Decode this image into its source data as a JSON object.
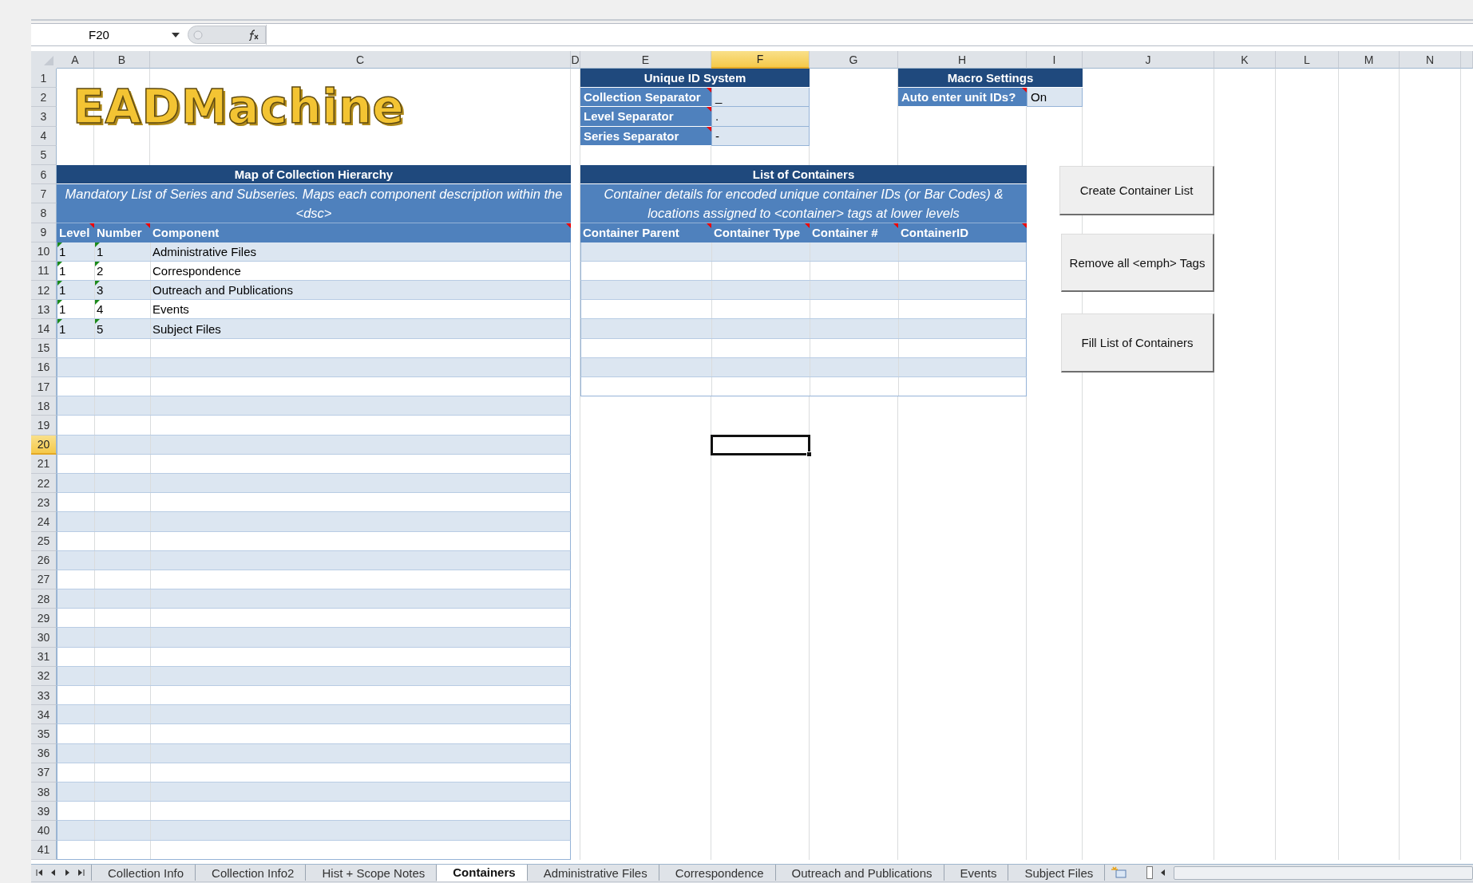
{
  "formula_bar": {
    "name_box": "F20"
  },
  "columns": [
    {
      "label": "A",
      "selected": false
    },
    {
      "label": "B",
      "selected": false
    },
    {
      "label": "C",
      "selected": false
    },
    {
      "label": "D",
      "selected": false
    },
    {
      "label": "E",
      "selected": false
    },
    {
      "label": "F",
      "selected": true
    },
    {
      "label": "G",
      "selected": false
    },
    {
      "label": "H",
      "selected": false
    },
    {
      "label": "I",
      "selected": false
    },
    {
      "label": "J",
      "selected": false
    },
    {
      "label": "K",
      "selected": false
    },
    {
      "label": "L",
      "selected": false
    },
    {
      "label": "M",
      "selected": false
    },
    {
      "label": "N",
      "selected": false
    }
  ],
  "rows": [
    {
      "label": "1",
      "selected": false
    },
    {
      "label": "2",
      "selected": false
    },
    {
      "label": "3",
      "selected": false
    },
    {
      "label": "4",
      "selected": false
    },
    {
      "label": "5",
      "selected": false
    },
    {
      "label": "6",
      "selected": false
    },
    {
      "label": "7",
      "selected": false
    },
    {
      "label": "8",
      "selected": false
    },
    {
      "label": "9",
      "selected": false
    },
    {
      "label": "10",
      "selected": false
    },
    {
      "label": "11",
      "selected": false
    },
    {
      "label": "12",
      "selected": false
    },
    {
      "label": "13",
      "selected": false
    },
    {
      "label": "14",
      "selected": false
    },
    {
      "label": "15",
      "selected": false
    },
    {
      "label": "16",
      "selected": false
    },
    {
      "label": "17",
      "selected": false
    },
    {
      "label": "18",
      "selected": false
    },
    {
      "label": "19",
      "selected": false
    },
    {
      "label": "20",
      "selected": true
    },
    {
      "label": "21",
      "selected": false
    },
    {
      "label": "22",
      "selected": false
    },
    {
      "label": "23",
      "selected": false
    },
    {
      "label": "24",
      "selected": false
    },
    {
      "label": "25",
      "selected": false
    },
    {
      "label": "26",
      "selected": false
    },
    {
      "label": "27",
      "selected": false
    },
    {
      "label": "28",
      "selected": false
    },
    {
      "label": "29",
      "selected": false
    },
    {
      "label": "30",
      "selected": false
    },
    {
      "label": "31",
      "selected": false
    },
    {
      "label": "32",
      "selected": false
    },
    {
      "label": "33",
      "selected": false
    },
    {
      "label": "34",
      "selected": false
    },
    {
      "label": "35",
      "selected": false
    },
    {
      "label": "36",
      "selected": false
    },
    {
      "label": "37",
      "selected": false
    },
    {
      "label": "38",
      "selected": false
    },
    {
      "label": "39",
      "selected": false
    },
    {
      "label": "40",
      "selected": false
    },
    {
      "label": "41",
      "selected": false
    }
  ],
  "logo": {
    "text": "EADMachine"
  },
  "unique_id_system": {
    "title": "Unique ID System",
    "fields": [
      {
        "label": "Collection Separator",
        "value": "_",
        "note": true
      },
      {
        "label": "Level Separator",
        "value": ".",
        "note": true
      },
      {
        "label": "Series Separator",
        "value": "-",
        "note": true
      }
    ]
  },
  "macro_settings": {
    "title": "Macro Settings",
    "fields": [
      {
        "label": "Auto enter unit IDs?",
        "value": "On",
        "note": true
      }
    ]
  },
  "hierarchy": {
    "title": "Map of Collection Hierarchy",
    "description": "Mandatory List of Series and Subseries. Maps each component description within the <dsc>",
    "columns": [
      {
        "label": "Level",
        "note": true
      },
      {
        "label": "Number",
        "note": true
      },
      {
        "label": "Component",
        "note": true
      }
    ],
    "rows": [
      {
        "level": "1",
        "number": "1",
        "component": "Administrative Files",
        "flagged": true
      },
      {
        "level": "1",
        "number": "2",
        "component": "Correspondence",
        "flagged": true
      },
      {
        "level": "1",
        "number": "3",
        "component": "Outreach and Publications",
        "flagged": true
      },
      {
        "level": "1",
        "number": "4",
        "component": "Events",
        "flagged": true
      },
      {
        "level": "1",
        "number": "5",
        "component": "Subject Files",
        "flagged": true
      }
    ]
  },
  "containers": {
    "title": "List of Containers",
    "description": "Container details for encoded unique container IDs (or Bar Codes) & locations assigned to <container> tags at lower levels",
    "columns": [
      {
        "label": "Container Parent",
        "note": true
      },
      {
        "label": "Container Type",
        "note": true
      },
      {
        "label": "Container #",
        "note": true
      },
      {
        "label": "ContainerID",
        "note": true
      }
    ]
  },
  "buttons": [
    "Create Container List",
    "Remove all <emph> Tags",
    "Fill List of Containers"
  ],
  "sheet_tabs": [
    {
      "label": "Collection Info",
      "selected": false
    },
    {
      "label": "Collection Info2",
      "selected": false
    },
    {
      "label": "Hist + Scope Notes",
      "selected": false
    },
    {
      "label": "Containers",
      "selected": true
    },
    {
      "label": "Administrative Files",
      "selected": false
    },
    {
      "label": "Correspondence",
      "selected": false
    },
    {
      "label": "Outreach and Publications",
      "selected": false
    },
    {
      "label": "Events",
      "selected": false
    },
    {
      "label": "Subject Files",
      "selected": false
    }
  ]
}
